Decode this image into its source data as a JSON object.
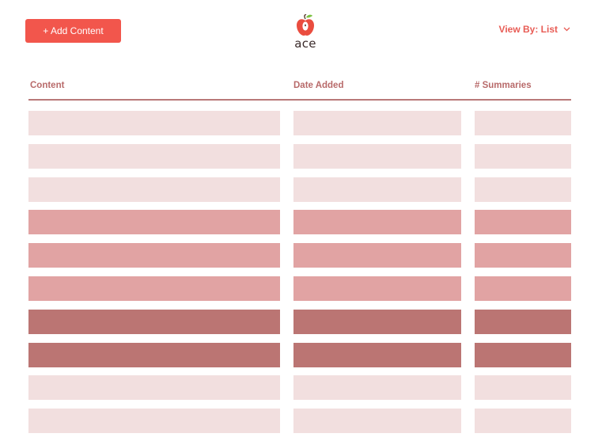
{
  "toolbar": {
    "add_label": "+ Add Content"
  },
  "brand": {
    "name": "ace"
  },
  "view": {
    "label": "View By: List"
  },
  "table": {
    "columns": [
      "Content",
      "Date Added",
      "# Summaries"
    ],
    "rows": [
      {
        "shade": "light"
      },
      {
        "shade": "light"
      },
      {
        "shade": "light"
      },
      {
        "shade": "medium"
      },
      {
        "shade": "medium"
      },
      {
        "shade": "medium"
      },
      {
        "shade": "dark"
      },
      {
        "shade": "dark"
      },
      {
        "shade": "light"
      },
      {
        "shade": "light"
      }
    ]
  },
  "colors": {
    "accent": "#f2564c",
    "header_text": "#b86a6a",
    "row_light": "#f2dfdf",
    "row_medium": "#e1a3a3",
    "row_dark": "#bb7573"
  }
}
